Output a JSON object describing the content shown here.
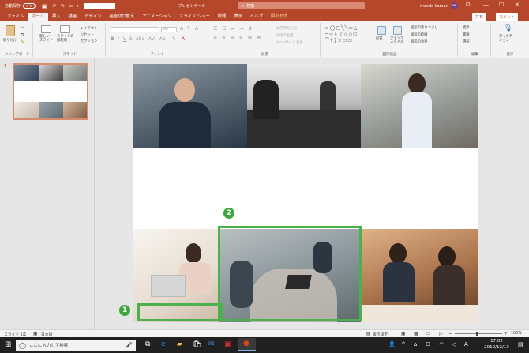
{
  "titlebar": {
    "autosave": "自動保存",
    "autosave_state": "オフ",
    "doc_title": "プレゼンテーシ",
    "search_placeholder": "検索",
    "user_name": "maeda kamari",
    "user_initials": "MK"
  },
  "tabs": [
    {
      "label": "ファイル"
    },
    {
      "label": "ホーム"
    },
    {
      "label": "挿入"
    },
    {
      "label": "描画"
    },
    {
      "label": "デザイン"
    },
    {
      "label": "画面切り替え"
    },
    {
      "label": "アニメーション"
    },
    {
      "label": "スライド ショー"
    },
    {
      "label": "校閲"
    },
    {
      "label": "表示"
    },
    {
      "label": "ヘルプ"
    },
    {
      "label": "図の形式"
    }
  ],
  "share": "共有",
  "comment": "コメント",
  "ribbon": {
    "clipboard": {
      "paste": "貼り付け",
      "label": "クリップボード"
    },
    "slides": {
      "new_slide": "新しい\nスライド",
      "reuse": "スライドの\n再利用",
      "layout": "レイアウト",
      "reset": "リセット",
      "section": "セクション",
      "label": "スライド"
    },
    "font": {
      "size": "60",
      "label": "フォント"
    },
    "paragraph": {
      "text_dir": "文字列の方向",
      "align_text": "文字の配置",
      "smartart": "SmartArt に変換",
      "label": "段落"
    },
    "drawing": {
      "arrange": "配置",
      "quick_styles": "クイック\nスタイル",
      "fill": "図形の塗りつぶし",
      "outline": "図形の枠線",
      "effects": "図形の効果",
      "label": "図形描画"
    },
    "editing": {
      "find": "検索",
      "replace": "置換",
      "select": "選択",
      "label": "編集"
    },
    "voice": {
      "dictate": "ディクテー\nション",
      "label": "音声"
    }
  },
  "thumbnail": {
    "number": "1"
  },
  "annotations": {
    "one": "1",
    "two": "2"
  },
  "statusbar": {
    "slide_info": "スライド 1/1",
    "language": "日本語",
    "display_settings": "表示設定",
    "zoom": "100%"
  },
  "taskbar": {
    "search_placeholder": "ここに入力して検索",
    "time": "17:02",
    "date": "2019/12/13",
    "ime": "A"
  },
  "colors": {
    "accent": "#b7472a",
    "annotation_green": "#4cb04c"
  }
}
